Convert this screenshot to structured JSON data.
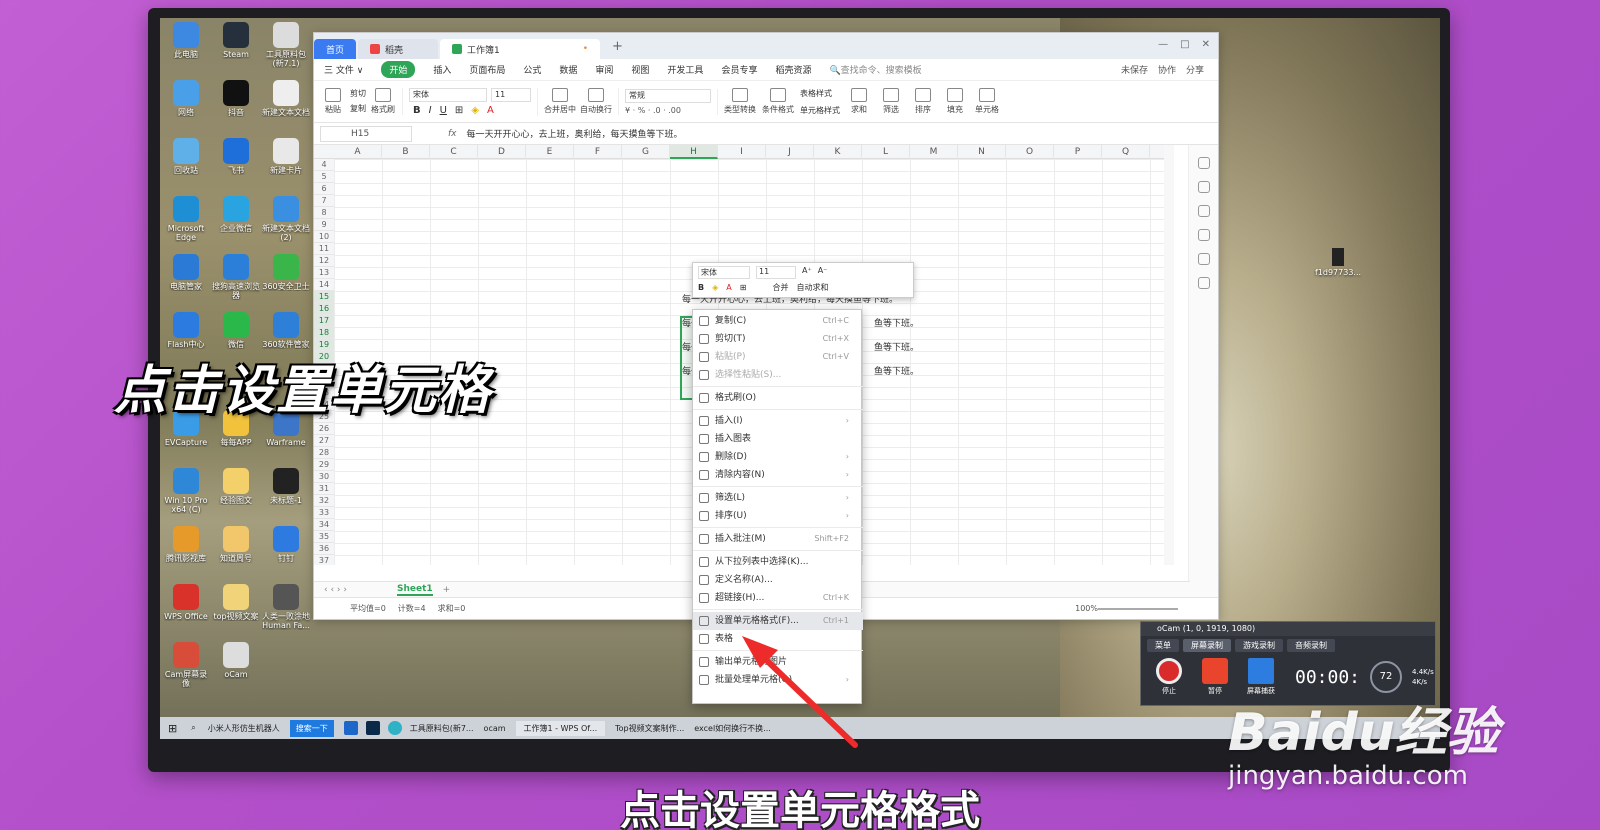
{
  "desktop": {
    "icons": [
      {
        "label": "此电脑"
      },
      {
        "label": "Steam"
      },
      {
        "label": "工具原料包(新7.1)"
      },
      {
        "label": "网络"
      },
      {
        "label": "抖音"
      },
      {
        "label": "新建文本文档"
      },
      {
        "label": "回收站"
      },
      {
        "label": "飞书"
      },
      {
        "label": "新建卡片"
      },
      {
        "label": "Microsoft Edge"
      },
      {
        "label": "企业微信"
      },
      {
        "label": "新建文本文档(2)"
      },
      {
        "label": "电脑管家"
      },
      {
        "label": "搜狗高速浏览器"
      },
      {
        "label": "360安全卫士"
      },
      {
        "label": "Flash中心"
      },
      {
        "label": "微信"
      },
      {
        "label": "360软件管家"
      },
      {
        "label": "EVCapture"
      },
      {
        "label": "每每APP"
      },
      {
        "label": "Warframe"
      },
      {
        "label": "Win 10 Pro x64 (C)"
      },
      {
        "label": "经验图文"
      },
      {
        "label": "未标题-1"
      },
      {
        "label": "腾讯影视库"
      },
      {
        "label": "知道周号"
      },
      {
        "label": "钉钉"
      },
      {
        "label": "WPS Office"
      },
      {
        "label": "top视频文案"
      },
      {
        "label": "人类一败涂地 Human Fa..."
      },
      {
        "label": "Cam屏幕录像"
      },
      {
        "label": "oCam"
      }
    ],
    "right_file": "f1d97733..."
  },
  "wps": {
    "tabs": {
      "home": "首页",
      "doc": "稻壳",
      "active": "工作簿1",
      "dirty_mark": "•",
      "new_tab": "+"
    },
    "window_controls": [
      "—",
      "□",
      "✕"
    ],
    "menu": {
      "file": "三 文件 ∨",
      "start": "开始",
      "items": [
        "插入",
        "页面布局",
        "公式",
        "数据",
        "审阅",
        "视图",
        "开发工具",
        "会员专享",
        "稻壳资源",
        "🔍查找命令、搜索模板"
      ],
      "right": [
        "未保存",
        "协作",
        "分享"
      ]
    },
    "toolbar": {
      "paste": "粘贴",
      "cut": "剪切",
      "copy": "复制",
      "format_painter": "格式刷",
      "font": "宋体",
      "size": "11",
      "merge": "合并居中",
      "wrap": "自动换行",
      "number_format": "常规",
      "type_convert": "类型转换",
      "cond_format": "条件格式",
      "table_style": "表格样式",
      "cell_style": "单元格样式",
      "sum": "求和",
      "filter": "筛选",
      "sort": "排序",
      "fill": "填充",
      "cell": "单元格"
    },
    "formula": {
      "cell_ref": "H15",
      "fx": "fx",
      "content": "每一天开开心心，去上班，奥利给，每天摸鱼等下班。"
    },
    "columns": [
      "A",
      "B",
      "C",
      "D",
      "E",
      "F",
      "G",
      "H",
      "I",
      "J",
      "K",
      "L",
      "M",
      "N",
      "O",
      "P",
      "Q"
    ],
    "rows": [
      "4",
      "5",
      "6",
      "7",
      "8",
      "9",
      "10",
      "11",
      "12",
      "13",
      "14",
      "15",
      "16",
      "17",
      "18",
      "19",
      "20",
      "21",
      "22",
      "23",
      "24",
      "25",
      "26",
      "27",
      "28",
      "29",
      "30",
      "31",
      "32",
      "33",
      "34",
      "35",
      "36",
      "37"
    ],
    "cell_fragments": [
      "每一天开开心心，去上班，奥利给，每天摸鱼等下班。",
      "鱼等下班。",
      "鱼等下班。",
      "鱼等下班。",
      "每一",
      "每一",
      "每一"
    ],
    "sheet": {
      "name": "Sheet1",
      "add": "+"
    },
    "status": {
      "avg": "平均值=0",
      "count": "计数=4",
      "sum": "求和=0",
      "zoom": "100%"
    }
  },
  "mini_toolbar": {
    "font": "宋体",
    "size": "11",
    "bold": "B",
    "merge": "合并",
    "autosum": "自动求和"
  },
  "context_menu": {
    "items": [
      {
        "label": "复制(C)",
        "shortcut": "Ctrl+C",
        "state": "normal"
      },
      {
        "label": "剪切(T)",
        "shortcut": "Ctrl+X",
        "state": "normal"
      },
      {
        "label": "粘贴(P)",
        "shortcut": "Ctrl+V",
        "state": "dim"
      },
      {
        "label": "选择性粘贴(S)...",
        "shortcut": "",
        "state": "dim"
      },
      {
        "label": "格式刷(O)",
        "shortcut": "",
        "state": "normal"
      },
      {
        "label": "插入(I)",
        "shortcut": "›",
        "state": "normal"
      },
      {
        "label": "插入图表",
        "shortcut": "",
        "state": "normal"
      },
      {
        "label": "删除(D)",
        "shortcut": "›",
        "state": "normal"
      },
      {
        "label": "清除内容(N)",
        "shortcut": "›",
        "state": "normal"
      },
      {
        "label": "筛选(L)",
        "shortcut": "›",
        "state": "normal"
      },
      {
        "label": "排序(U)",
        "shortcut": "›",
        "state": "normal"
      },
      {
        "label": "插入批注(M)",
        "shortcut": "Shift+F2",
        "state": "normal"
      },
      {
        "label": "从下拉列表中选择(K)...",
        "shortcut": "",
        "state": "normal"
      },
      {
        "label": "定义名称(A)...",
        "shortcut": "",
        "state": "normal"
      },
      {
        "label": "超链接(H)...",
        "shortcut": "Ctrl+K",
        "state": "normal"
      },
      {
        "label": "设置单元格格式(F)...",
        "shortcut": "Ctrl+1",
        "state": "highlight"
      },
      {
        "label": "表格",
        "shortcut": "",
        "state": "normal"
      },
      {
        "label": "输出单元格为图片",
        "shortcut": "",
        "state": "normal"
      },
      {
        "label": "批量处理单元格(Q)",
        "shortcut": "›",
        "state": "normal"
      }
    ]
  },
  "ocam": {
    "title": "oCam (1, 0, 1919, 1080)",
    "tabs": [
      "菜单",
      "屏幕录制",
      "游戏录制",
      "音频录制"
    ],
    "buttons": [
      "停止",
      "暂停",
      "屏幕捕获"
    ],
    "time": "00:00:",
    "rate_top": "4.4K/s",
    "rate_bottom": "4K/s",
    "cpu": "72"
  },
  "taskbar": {
    "items": [
      "小米人形仿生机器人",
      "搜索一下",
      "工具原料包(新7...",
      "ocam",
      "工作簿1 - WPS Of...",
      "Top视频文案制作...",
      "excel如何换行不换..."
    ]
  },
  "overlay": {
    "title": "点击设置单元格",
    "subtitle": "点击设置单元格格式"
  },
  "watermark": {
    "brand": "Baidu经验",
    "url": "jingyan.baidu.com"
  },
  "colors": {
    "accent_green": "#2fa657",
    "wps_blue": "#3a7bf2",
    "arrow_red": "#ee2b2b"
  }
}
